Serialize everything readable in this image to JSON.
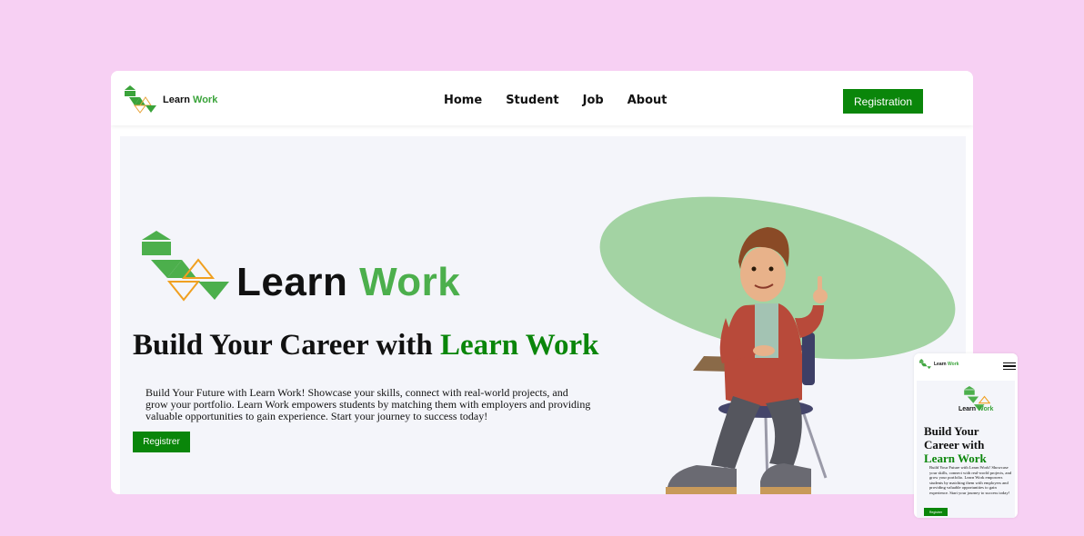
{
  "brand": {
    "name_part1": "Learn",
    "name_part2": "Work"
  },
  "nav": {
    "items": [
      "Home",
      "Student",
      "Job",
      "About"
    ],
    "register_label": "Registration"
  },
  "hero": {
    "headline_part1": "Build Your Career with",
    "headline_part2": "Learn Work",
    "paragraph": "Build Your Future with Learn Work! Showcase your skills, connect with real-world projects, and grow your portfolio. Learn Work empowers students by matching them with employers and providing valuable opportunities to gain experience. Start your journey to success today!",
    "cta_label": "Registrer"
  },
  "mobile": {
    "headline_part1": "Build Your Career with",
    "headline_part2": "Learn Work",
    "cta_label": "Registrer"
  },
  "colors": {
    "background": "#f7d0f3",
    "accent": "#0a860a",
    "logo_green": "#4caf4c",
    "blob": "#a3d3a3"
  }
}
